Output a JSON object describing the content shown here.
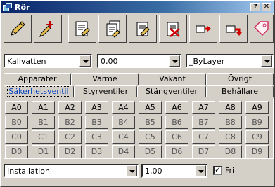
{
  "window": {
    "title": "Rör"
  },
  "toolbar": {
    "tools": [
      {
        "icon": "pencil-icon"
      },
      {
        "icon": "connect-pencil-icon"
      },
      {
        "icon": "document-edit-icon"
      },
      {
        "icon": "document-stack-icon"
      },
      {
        "icon": "document-pen-icon"
      },
      {
        "icon": "document-delete-icon"
      },
      {
        "icon": "red-pipe-arrow-icon"
      },
      {
        "icon": "red-pipe-arrow-2-icon"
      },
      {
        "icon": "tag-icon"
      }
    ]
  },
  "combos_top": {
    "medium": "Kallvatten",
    "dimension": "0,00",
    "layer": "_ByLayer"
  },
  "tabs_back": [
    "Apparater",
    "Värme",
    "Vakant",
    "Övrigt"
  ],
  "tabs_front": [
    "Säkerhetsventil",
    "Styrventiler",
    "Stängventiler",
    "Behållare"
  ],
  "keys": [
    [
      "A0",
      "A1",
      "A2",
      "A3",
      "A4",
      "A5",
      "A6",
      "A7",
      "A8",
      "A9"
    ],
    [
      "B0",
      "B1",
      "B2",
      "B3",
      "B4",
      "B5",
      "B6",
      "B7",
      "B8",
      "B9"
    ],
    [
      "C0",
      "C1",
      "C2",
      "C3",
      "C4",
      "C5",
      "C6",
      "C7",
      "C8",
      "C9"
    ],
    [
      "D0",
      "D1",
      "D2",
      "D3",
      "D4",
      "D5",
      "D6",
      "D7",
      "D8",
      "D9"
    ]
  ],
  "combos_bottom": {
    "category": "Installation",
    "scale": "1,00"
  },
  "checkbox": {
    "label": "Fri",
    "checked": true
  }
}
